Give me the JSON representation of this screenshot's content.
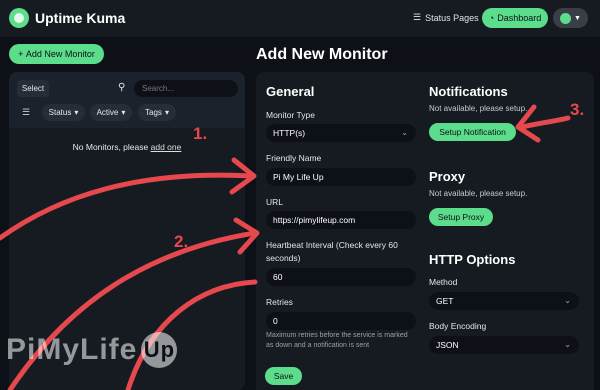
{
  "app": {
    "title": "Uptime Kuma"
  },
  "header": {
    "status_pages_label": "Status Pages",
    "dashboard_label": "Dashboard"
  },
  "sidebar": {
    "add_button_label": "Add New Monitor",
    "select_label": "Select",
    "search_placeholder": "Search...",
    "filters": [
      "Status",
      "Active",
      "Tags"
    ],
    "empty_text": "No Monitors, please",
    "empty_link": "add one"
  },
  "page": {
    "title": "Add New Monitor"
  },
  "general": {
    "title": "General",
    "monitor_type_label": "Monitor Type",
    "monitor_type_value": "HTTP(s)",
    "friendly_name_label": "Friendly Name",
    "friendly_name_value": "Pi My Life Up",
    "url_label": "URL",
    "url_value": "https://pimylifeup.com",
    "heartbeat_label_line1": "Heartbeat Interval (Check every 60",
    "heartbeat_label_line2": "seconds)",
    "heartbeat_value": "60",
    "retries_label": "Retries",
    "retries_value": "0",
    "retries_help_line1": "Maximum retries before the service is marked",
    "retries_help_line2": "as down and a notification is sent"
  },
  "notifications": {
    "title": "Notifications",
    "note": "Not available, please setup.",
    "button_label": "Setup Notification"
  },
  "proxy": {
    "title": "Proxy",
    "note": "Not available, please setup.",
    "button_label": "Setup Proxy"
  },
  "http_options": {
    "title": "HTTP Options",
    "method_label": "Method",
    "method_value": "GET",
    "body_encoding_label": "Body Encoding",
    "body_encoding_value": "JSON"
  },
  "footer": {
    "save_label": "Save"
  },
  "annotations": {
    "step1": "1.",
    "step2": "2.",
    "step3": "3."
  },
  "watermark": {
    "text_left": "PiMyLife",
    "text_right": "Up"
  },
  "colors": {
    "accent": "#5cdd8b",
    "annotation": "#e5484d",
    "background": "#0d1117",
    "panel": "#161b22"
  },
  "icons": [
    "logo-icon",
    "status-pages-icon",
    "dashboard-icon",
    "avatar-icon",
    "chevron-down-icon",
    "plus-icon",
    "search-icon",
    "filter-icon"
  ]
}
